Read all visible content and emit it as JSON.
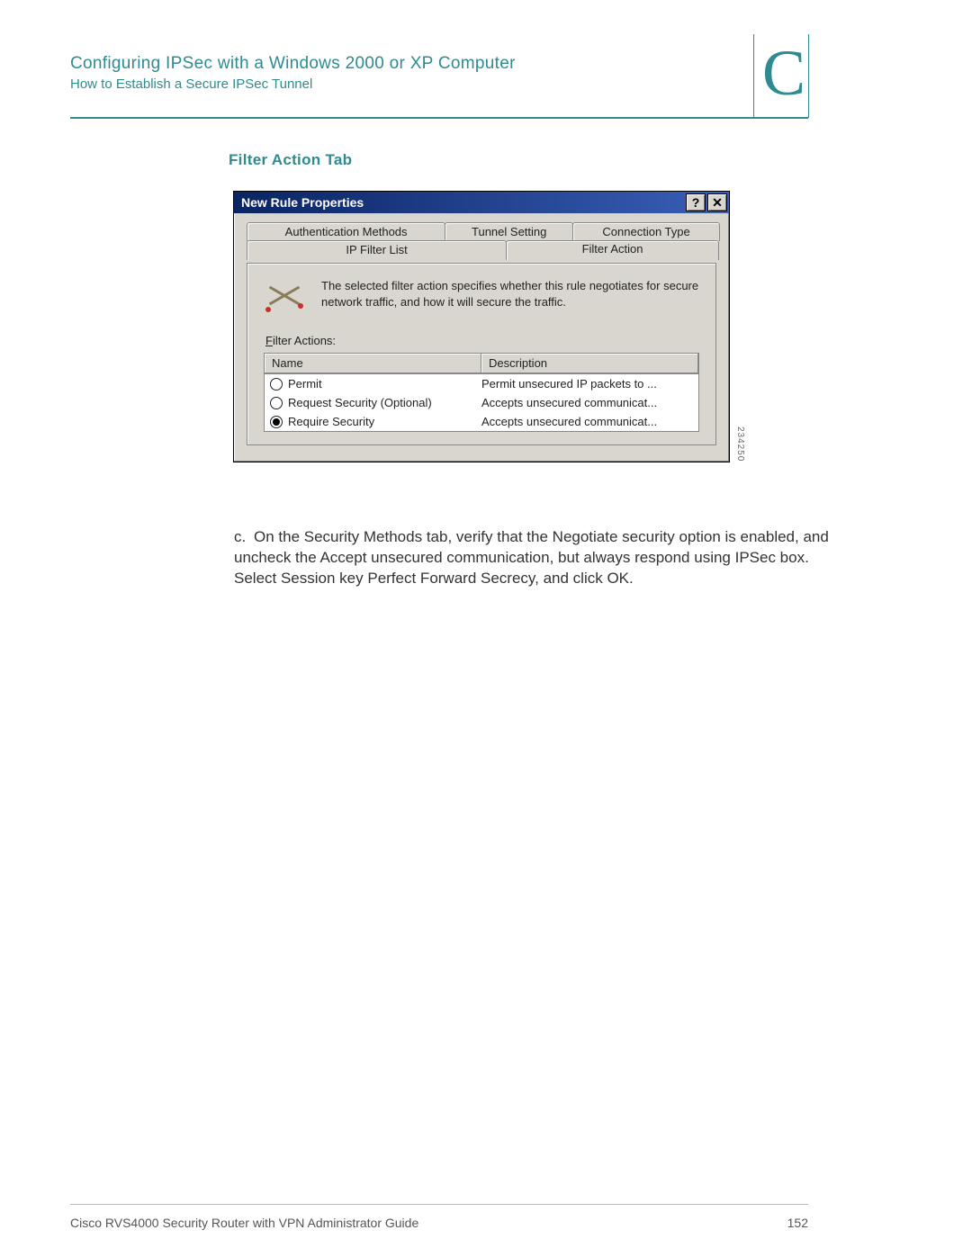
{
  "header": {
    "title": "Configuring IPSec with a Windows 2000 or XP Computer",
    "subtitle": "How to Establish a Secure IPSec Tunnel",
    "appendix_letter": "C"
  },
  "section_title": "Filter Action Tab",
  "dialog": {
    "title": "New Rule Properties",
    "help_btn": "?",
    "close_btn": "✕",
    "side_label": "234250",
    "tabs_back": [
      {
        "label": "Authentication Methods"
      },
      {
        "label": "Tunnel Setting"
      },
      {
        "label": "Connection Type"
      }
    ],
    "tabs_front": [
      {
        "label": "IP Filter List"
      },
      {
        "label": "Filter Action"
      }
    ],
    "description": "The selected filter action specifies whether this rule negotiates for secure network traffic, and how it will secure the traffic.",
    "filter_actions_label_pre": "F",
    "filter_actions_label_post": "ilter Actions:",
    "columns": {
      "name": "Name",
      "desc": "Description"
    },
    "rows": [
      {
        "selected": false,
        "name": "Permit",
        "desc": "Permit unsecured IP packets to ..."
      },
      {
        "selected": false,
        "name": "Request Security (Optional)",
        "desc": "Accepts unsecured communicat..."
      },
      {
        "selected": true,
        "name": "Require Security",
        "desc": "Accepts unsecured communicat..."
      }
    ]
  },
  "step": {
    "marker": "c.",
    "text": "On the Security Methods tab, verify that the Negotiate security option is enabled, and uncheck the Accept unsecured communication, but always respond using IPSec box. Select Session key Perfect Forward Secrecy, and click OK."
  },
  "footer": {
    "left": "Cisco RVS4000 Security Router with VPN Administrator Guide",
    "page": "152"
  }
}
